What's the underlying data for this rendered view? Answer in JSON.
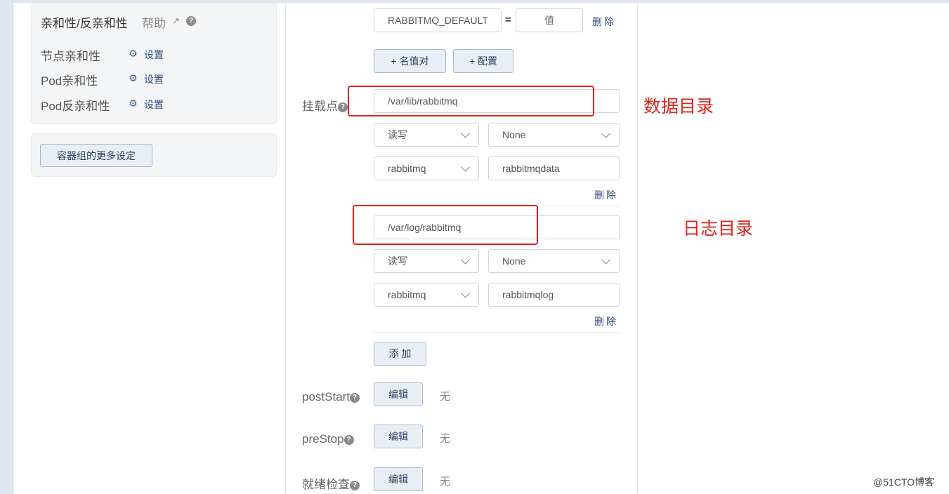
{
  "affinity": {
    "title": "亲和性/反亲和性",
    "help": "帮助",
    "rows": [
      {
        "label": "节点亲和性",
        "action": "设置"
      },
      {
        "label": "Pod亲和性",
        "action": "设置"
      },
      {
        "label": "Pod反亲和性",
        "action": "设置"
      }
    ]
  },
  "more_settings_button": "容器组的更多设定",
  "env": {
    "name_value": "RABBITMQ_DEFAULT",
    "equals": "=",
    "value_placeholder": "值",
    "delete": "删除",
    "add_pair": "+ 名值对",
    "add_config": "+ 配置"
  },
  "mounts": {
    "label": "挂载点",
    "items": [
      {
        "path": "/var/lib/rabbitmq",
        "mode": "读写",
        "propagation": "None",
        "volume": "rabbitmq",
        "subpath": "rabbitmqdata",
        "delete": "删除"
      },
      {
        "path": "/var/log/rabbitmq",
        "mode": "读写",
        "propagation": "None",
        "volume": "rabbitmq",
        "subpath": "rabbitmqlog",
        "delete": "删除"
      }
    ],
    "add": "添 加"
  },
  "lifecycle": [
    {
      "label": "postStart",
      "button": "编辑",
      "value": "无"
    },
    {
      "label": "preStop",
      "button": "编辑",
      "value": "无"
    },
    {
      "label": "就绪检查",
      "button": "编辑",
      "value": "无"
    }
  ],
  "annotations": {
    "data_dir": "数据目录",
    "log_dir": "日志目录"
  },
  "watermark": "@51CTO博客",
  "colors": {
    "annotation": "#e0231c",
    "button_bg": "#e8eef6",
    "link": "#2d4f7c"
  }
}
